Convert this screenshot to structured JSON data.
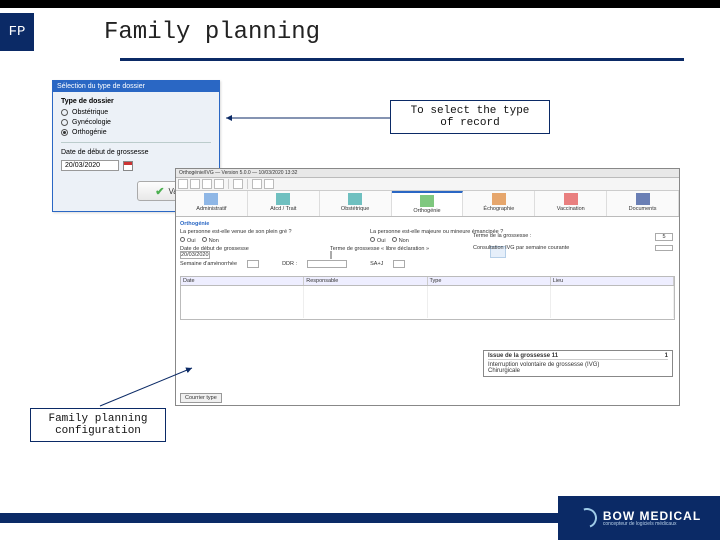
{
  "header": {
    "chip": "FP",
    "title": "Family planning"
  },
  "annotations": {
    "select_type": "To select the type\nof record",
    "fp_config": "Family planning\nconfiguration"
  },
  "dialog": {
    "title": "Sélection du type de dossier",
    "group_label": "Type de dossier",
    "options": [
      "Obstétrique",
      "Gynécologie",
      "Orthogénie"
    ],
    "selected_index": 2,
    "date_label": "Date de début de grossesse",
    "date_value": "20/03/2020",
    "validate": "Valider"
  },
  "app": {
    "titlebar": "Orthogénie/IVG — Version 5.0.0 — 10/03/2020 13:32",
    "tabs": [
      "Administratif",
      "Atcd / Trait",
      "Obstétrique",
      "Orthogénie",
      "Échographie",
      "Vaccination",
      "Documents"
    ],
    "active_tab_index": 3,
    "section": "Orthogénie",
    "q1": "La personne est-elle venue de son plein gré ?",
    "q2": "La personne est-elle majeure ou mineure émancipée ?",
    "yes": "Oui",
    "no": "Non",
    "dg_label": "Date de début de grossesse",
    "dg_value": "20/03/2020",
    "term_label": "Terme de grossesse « libre déclaration »",
    "ddr_label": "DDR :",
    "sa_label": "SA+J",
    "sem": "Semaine d'aménorrhée",
    "terme_label": "Terme de la grossesse :",
    "terme_value": "5",
    "consult_label": "Consultation IVG par semaine courante",
    "consult_value": "",
    "grid_cols": [
      "Date",
      "Responsable",
      "Type",
      "Lieu"
    ],
    "issue": {
      "title": "Issue de la grossesse 11",
      "num": "1",
      "line1": "Interruption volontaire de grossesse (IVG)",
      "line2": "Chirurgicale"
    },
    "footer_btn": "Courrier type"
  },
  "logo": {
    "brand": "BOW MEDICAL",
    "tagline": "concepteur de logiciels médicaux"
  }
}
